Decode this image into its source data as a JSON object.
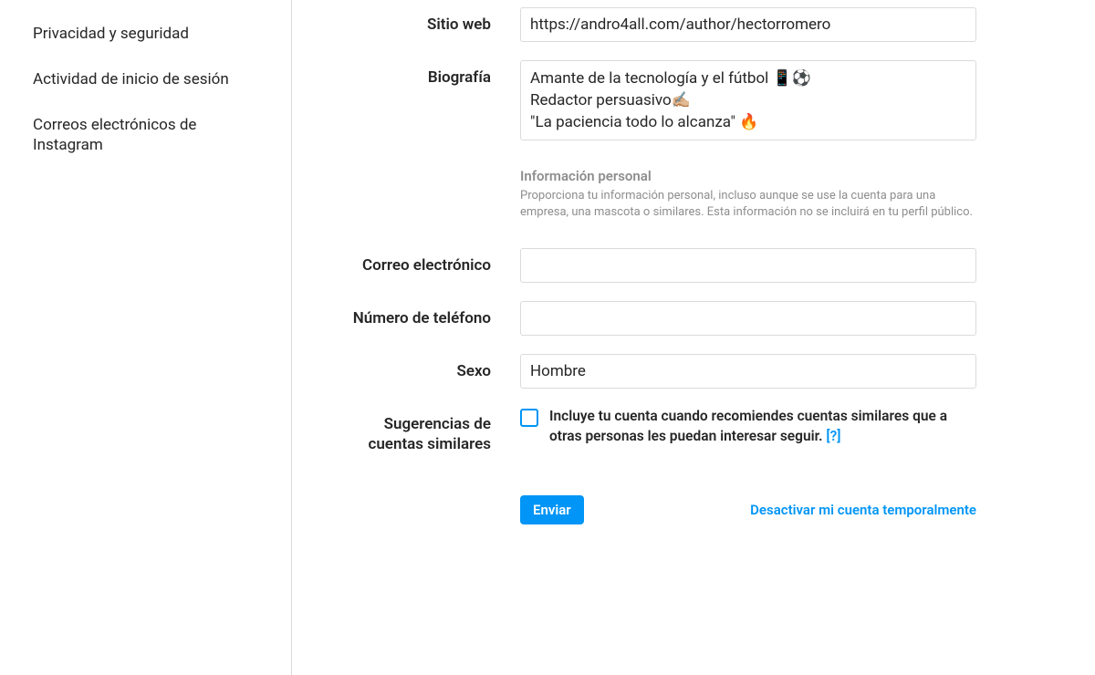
{
  "sidebar": {
    "items": [
      {
        "label": "Privacidad y seguridad"
      },
      {
        "label": "Actividad de inicio de sesión"
      },
      {
        "label": "Correos electrónicos de Instagram"
      }
    ]
  },
  "form": {
    "website": {
      "label": "Sitio web",
      "value": "https://andro4all.com/author/hectorromero"
    },
    "bio": {
      "label": "Biografía",
      "value": "Amante de la tecnología y el fútbol 📱⚽\nRedactor persuasivo✍🏼\n\"La paciencia todo lo alcanza\" 🔥"
    },
    "personal_info": {
      "title": "Información personal",
      "desc": "Proporciona tu información personal, incluso aunque se use la cuenta para una empresa, una mascota o similares. Esta información no se incluirá en tu perfil público."
    },
    "email": {
      "label": "Correo electrónico",
      "value": ""
    },
    "phone": {
      "label": "Número de teléfono",
      "value": ""
    },
    "gender": {
      "label": "Sexo",
      "value": "Hombre"
    },
    "suggestions": {
      "label": "Sugerencias de cuentas similares",
      "checkbox_label": "Incluye tu cuenta cuando recomiendes cuentas similares que a otras personas les puedan interesar seguir.",
      "help": "[?]"
    }
  },
  "actions": {
    "submit": "Enviar",
    "deactivate": "Desactivar mi cuenta temporalmente"
  }
}
